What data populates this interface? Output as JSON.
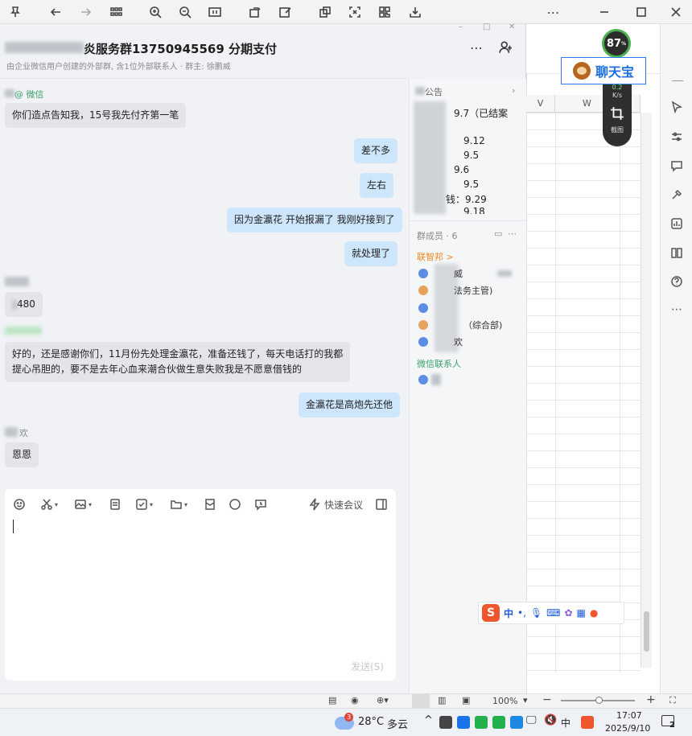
{
  "chat": {
    "title": "炎服务群13750945569 分期支付",
    "subtitle": "由企业微信用户创建的外部群, 含1位外部联系人 · 群主: 徐鹏威",
    "messages": [
      {
        "side": "left",
        "sender": "@ 微信",
        "text": "你们造点告知我，15号我先付齐第一笔"
      },
      {
        "side": "right",
        "text": "差不多"
      },
      {
        "side": "right",
        "text": "左右"
      },
      {
        "side": "right",
        "text": "因为金瀛花 开始报漏了 我刚好接到了"
      },
      {
        "side": "right",
        "text": "就处理了"
      },
      {
        "side": "left",
        "sender": "",
        "text": "480"
      },
      {
        "side": "left",
        "sender": "",
        "text_line1": "好的，还是感谢你们，11月份先处理金瀛花，准备还钱了，每天电话打的我都",
        "text_line2": "提心吊胆的，要不是去年心血来潮合伙做生意失败我是不愿意借钱的"
      },
      {
        "side": "right",
        "text": "金瀛花是高炮先还他"
      },
      {
        "side": "left",
        "sender": "欢",
        "text": "恩恩"
      }
    ]
  },
  "announcement": {
    "heading": "公告",
    "lines": [
      "9.7（已结案",
      "9.12",
      "9.5",
      "9.6",
      "9.5",
      "钱：9.29",
      "9.18"
    ]
  },
  "members": {
    "heading": "群成员 · 6",
    "group_label": "联智邦 >",
    "list": [
      "威",
      "法务主管)",
      "",
      "（综合部)",
      "欢"
    ],
    "external_label": "微信联系人"
  },
  "composer": {
    "quick_meeting": "快速会议",
    "send": "发送(S)"
  },
  "overlay": {
    "percent": "87",
    "percent_unit": "%",
    "speed": "0.2",
    "speed_unit": "K/s",
    "screenshot_label": "截图",
    "app_label": "聊天宝"
  },
  "sheet": {
    "columns": [
      "V",
      "W"
    ]
  },
  "ime": {
    "logo": "S",
    "mode": "中"
  },
  "statusbar": {
    "zoom": "100%"
  },
  "taskbar": {
    "weather_badge": "3",
    "temperature": "28°C",
    "weather": "多云",
    "input_lang": "中",
    "time": "17:07",
    "date": "2025/9/10",
    "notif_count": "2"
  }
}
